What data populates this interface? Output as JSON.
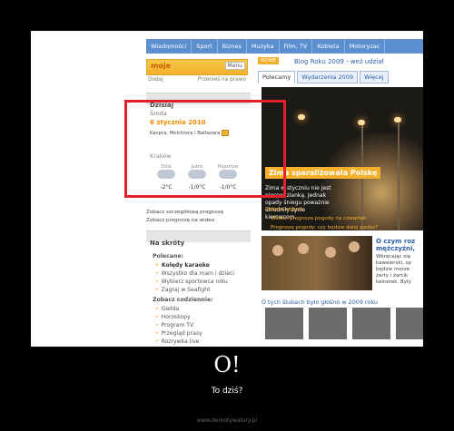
{
  "nav": [
    "Wiadomości",
    "Sport",
    "Biznes",
    "Muzyka",
    "Film, TV",
    "Kobieta",
    "Motoryzac"
  ],
  "brand": {
    "logo": "moje",
    "menu": "Menu"
  },
  "tag_add": "Dodaj",
  "tag_move": "Przenieś na prawo",
  "today": {
    "heading": "Dzisiaj",
    "day": "Środa",
    "date": "6 stycznia 2010",
    "names": "Kacpra, Melchiora i Baltazara"
  },
  "weather": {
    "city": "Kraków",
    "items": [
      {
        "label": "Dziś",
        "temp": "-2°C"
      },
      {
        "label": "Jutro",
        "temp": "-1/0°C"
      },
      {
        "label": "Pojutrze",
        "temp": "-1/0°C"
      }
    ],
    "more1": "Zobacz szczegółową prognozę",
    "more2": "Zobacz prognozę na wideo"
  },
  "shortcuts": {
    "heading": "Na skróty",
    "popular": "Polecane:",
    "popular_items": [
      "Kolędy karaoke",
      "Wszystko dla mam i dzieci",
      "Wybierz sportowca roku",
      "Zagraj w Seafight"
    ],
    "daily": "Zobacz codziennie:",
    "daily_items": [
      "Giełda",
      "Horoskopy",
      "Program TV",
      "Przegląd prasy",
      "Rozrywka live"
    ]
  },
  "right": {
    "badge": "NOWE",
    "blog": "Blog Roku 2009 - weź udział",
    "tabs": [
      "Polecamy",
      "Wydarzenia 2009",
      "Więcej"
    ],
    "hero_title": "Zima sparaliżowała Polskę",
    "hero_text": "Zima w styczniu nie jest niespodzianką. Jednak opady śniegu poważnie utrudniły życie kierowcom.",
    "hero_link1": "Zobacz zdjęcia",
    "hero_link2": "Wideo: prognoza pogody na czwartek",
    "hero_link3": "Prognoza pogody: czy będzie dalej padać?",
    "side_head": "O czym roz mężczyźni,",
    "side_text": "Wkręcając się kawalerski, sp będzie morze żarty i żarcik kelnerek. Były",
    "ostat": "O tych ślubach było głośno w 2009 roku"
  },
  "caption": {
    "title": "O!",
    "subtitle": "To dziś?",
    "watermark": "www.demotywatory.pl"
  },
  "colors": {
    "accent": "#f4b02c",
    "highlight": "#e4202a",
    "link": "#2a5ea8"
  }
}
